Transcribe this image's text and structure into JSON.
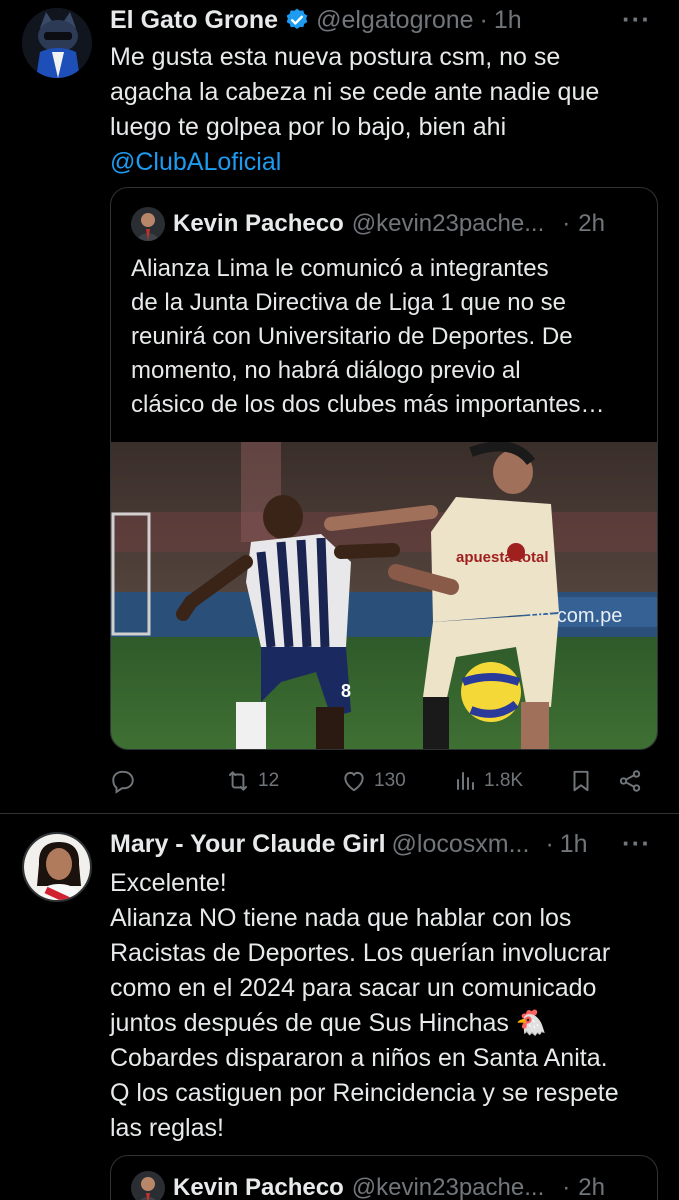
{
  "tweets": [
    {
      "author": "El Gato Grone",
      "handle": "@elgatogrone",
      "dot": "·",
      "time": "1h",
      "text_lines": [
        "Me gusta esta nueva postura csm, no se",
        "agacha la cabeza ni se cede ante nadie que",
        "luego te golpea por lo bajo, bien ahi"
      ],
      "mention": "@ClubALoficial",
      "quote": {
        "author": "Kevin Pacheco",
        "handle": "@kevin23pache...",
        "dot": "·",
        "time": "2h",
        "text_lines": [
          "Alianza Lima le comunicó a integrantes",
          "de la Junta Directiva de Liga 1 que no se",
          "reunirá con Universitario de Deportes. De",
          "momento, no habrá diálogo previo al",
          "clásico de los dos clubes más importantes…"
        ],
        "photo_text": {
          "jersey_left": "8",
          "jersey_right_sponsor": "apuesta total",
          "banner": "pe.com.pe"
        }
      },
      "actions": {
        "reply": "",
        "retweets": "12",
        "likes": "130",
        "views": "1.8K"
      }
    },
    {
      "author": "Mary - Your Claude Girl",
      "handle": "@locosxm...",
      "dot": "·",
      "time": "1h",
      "text_lines": [
        "Excelente!",
        "Alianza NO tiene nada que hablar con los",
        "Racistas de Deportes. Los querían involucrar",
        "como en el 2024 para sacar un comunicado",
        "juntos después de que Sus Hinchas 🐔",
        "Cobardes dispararon a niños en Santa Anita.",
        "Q los castiguen por Reincidencia y se respete",
        "las reglas!"
      ],
      "quote": {
        "author": "Kevin Pacheco",
        "handle": "@kevin23pache...",
        "dot": "·",
        "time": "2h"
      }
    }
  ],
  "more_label": "···",
  "colors": {
    "background": "#000000",
    "text": "#e7e9ea",
    "muted": "#71767b",
    "link": "#1d9bf0",
    "verified": "#1d9bf0",
    "border": "#2f3336"
  },
  "icons": {
    "verified": "verified-badge-icon",
    "reply": "reply-icon",
    "retweet": "retweet-icon",
    "like": "heart-icon",
    "views": "views-icon",
    "bookmark": "bookmark-icon",
    "share": "share-icon"
  }
}
